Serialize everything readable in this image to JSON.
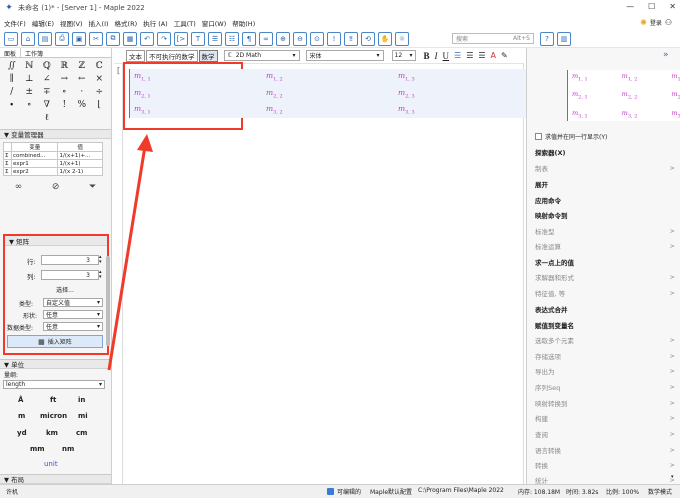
{
  "window": {
    "title": "未命名 (1)* - [Server 1] - Maple 2022",
    "login": "登录",
    "controls": [
      "—",
      "☐",
      "✕"
    ]
  },
  "menu": [
    "文件(F)",
    "编辑(E)",
    "视图(V)",
    "插入(I)",
    "格式(R)",
    "执行 (A)",
    "工具(T)",
    "窗口(W)",
    "帮助(H)"
  ],
  "search": {
    "placeholder": "搜索",
    "shortcut": "Alt+S"
  },
  "left_tabs": [
    "面板",
    "工作簿"
  ],
  "palette_symbols": [
    "∬",
    "ℕ",
    "ℚ",
    "ℝ",
    "ℤ",
    "ℂ",
    "∥",
    "⊥",
    "∠",
    "→",
    "←",
    "×",
    "/",
    "±",
    "∓",
    "∘",
    "·",
    "÷",
    "∙",
    "∘",
    "∇",
    "!",
    "%",
    "⌊",
    "ℓ"
  ],
  "var_manager": {
    "title": "▼ 变量管理器",
    "headers": [
      "",
      "变量",
      "值"
    ],
    "rows": [
      {
        "sym": "Σ",
        "name": "combined...",
        "value": "1/(x+1)+..."
      },
      {
        "sym": "Σ",
        "name": "expr1",
        "value": "1/(x+1)"
      },
      {
        "sym": "Σ",
        "name": "expr2",
        "value": "1/(x 2-1)"
      }
    ]
  },
  "matrix_panel": {
    "title": "▼ 矩阵",
    "rows_label": "行:",
    "rows_value": "3",
    "cols_label": "列:",
    "cols_value": "3",
    "choose_label": "选择...",
    "type_label": "类型:",
    "type_value": "自定义值",
    "shape_label": "形状:",
    "shape_value": "任意",
    "dtype_label": "数据类型:",
    "dtype_value": "任意",
    "insert_label": "插入矩阵"
  },
  "units_panel": {
    "title": "▼ 单位",
    "dim_label": "量纲:",
    "dim_value": "length",
    "units": [
      "Å",
      "ft",
      "in",
      "m",
      "micron",
      "mi",
      "yd",
      "km",
      "cm",
      "mm",
      "nm"
    ],
    "unit_label": "unit"
  },
  "layout_panel": {
    "title": "▼ 布局"
  },
  "format_bar": {
    "text_tab": "文本",
    "nonexec_tab": "不可执行的数学",
    "math_tab": "数学",
    "mode": "2D Math",
    "font": "宋体",
    "size": "12"
  },
  "matrix_entries": [
    [
      "m",
      "1, 1"
    ],
    [
      "m",
      "1, 2"
    ],
    [
      "m",
      "1, 3"
    ],
    [
      "m",
      "2, 1"
    ],
    [
      "m",
      "2, 2"
    ],
    [
      "m",
      "2, 3"
    ],
    [
      "m",
      "3, 1"
    ],
    [
      "m",
      "3, 2"
    ],
    [
      "m",
      "3, 3"
    ]
  ],
  "context_panel": {
    "checkbox_label": "求值并在同一行显示(Y)",
    "items": [
      {
        "label": "探索器(X)",
        "style": "bold",
        "arrow": ""
      },
      {
        "label": "制表",
        "style": "dis",
        "arrow": ">"
      },
      {
        "label": "展开",
        "style": "bold",
        "arrow": ""
      },
      {
        "label": "应用命令",
        "style": "bold",
        "arrow": ""
      },
      {
        "label": "映射命令到",
        "style": "bold",
        "arrow": ""
      },
      {
        "label": "标准型",
        "style": "dis",
        "arrow": ">"
      },
      {
        "label": "标准运算",
        "style": "dis",
        "arrow": ">"
      },
      {
        "label": "求一点上的值",
        "style": "bold",
        "arrow": ""
      },
      {
        "label": "求解器和形式",
        "style": "dis",
        "arrow": ">"
      },
      {
        "label": "特征值, 等",
        "style": "dis",
        "arrow": ">"
      },
      {
        "label": "表达式合并",
        "style": "bold",
        "arrow": ""
      },
      {
        "label": "赋值到变量名",
        "style": "bold",
        "arrow": ""
      },
      {
        "label": "选取多个元素",
        "style": "dis",
        "arrow": ">"
      },
      {
        "label": "存储选项",
        "style": "dis",
        "arrow": ">"
      },
      {
        "label": "导出为",
        "style": "dis",
        "arrow": ">"
      },
      {
        "label": "序列Seq",
        "style": "dis",
        "arrow": ">"
      },
      {
        "label": "映射转换到",
        "style": "dis",
        "arrow": ">"
      },
      {
        "label": "构建",
        "style": "dis",
        "arrow": ">"
      },
      {
        "label": "查阅",
        "style": "dis",
        "arrow": ">"
      },
      {
        "label": "语言转换",
        "style": "dis",
        "arrow": ">"
      },
      {
        "label": "转换",
        "style": "dis",
        "arrow": ">"
      },
      {
        "label": "统计",
        "style": "dis",
        "arrow": ">"
      }
    ]
  },
  "status": {
    "mode": "许机",
    "ready_label": "可编辑的",
    "config": "Maple默认配置",
    "path": "C:\\Program Files\\Maple 2022",
    "memory": "内存: 108.18M",
    "time": "时间: 3.82s",
    "zoom": "比例: 100%",
    "math_mode": "数学模式"
  },
  "colors": {
    "accent": "#3a7bd5",
    "highlight": "#f03a2a",
    "matrix": "#c23dc5"
  }
}
